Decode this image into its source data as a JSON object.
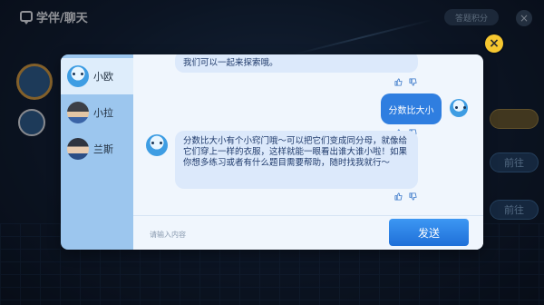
{
  "top_bar": {
    "title": "学伴/聊天",
    "pill_label": "答题积分"
  },
  "background": {
    "right_buttons": [
      "前往",
      "前往",
      "前往"
    ]
  },
  "sidebar": {
    "items": [
      {
        "label": "小欧",
        "avatar": "ou-avatar",
        "active": true
      },
      {
        "label": "小拉",
        "avatar": "la-avatar",
        "active": false
      },
      {
        "label": "兰斯",
        "avatar": "lan-avatar",
        "active": false
      }
    ]
  },
  "chat": {
    "messages": [
      {
        "from": "assistant",
        "text": "我们可以一起来探索哦。"
      },
      {
        "from": "user",
        "text": "分数比大小"
      },
      {
        "from": "assistant",
        "text": "分数比大小有个小窍门哦～可以把它们变成同分母，就像给它们穿上一样的衣服，这样就能一眼看出谁大谁小啦！如果你想多练习或者有什么题目需要帮助，随时找我就行～"
      }
    ]
  },
  "input": {
    "placeholder": "请输入内容",
    "value": ""
  },
  "send_button": {
    "label": "发送"
  },
  "close_button": {
    "label": "×"
  },
  "top_close": {
    "label": "×"
  },
  "colors": {
    "accent": "#2f7ee0",
    "sidebar": "#9cc6ee",
    "close": "#f6c730"
  }
}
